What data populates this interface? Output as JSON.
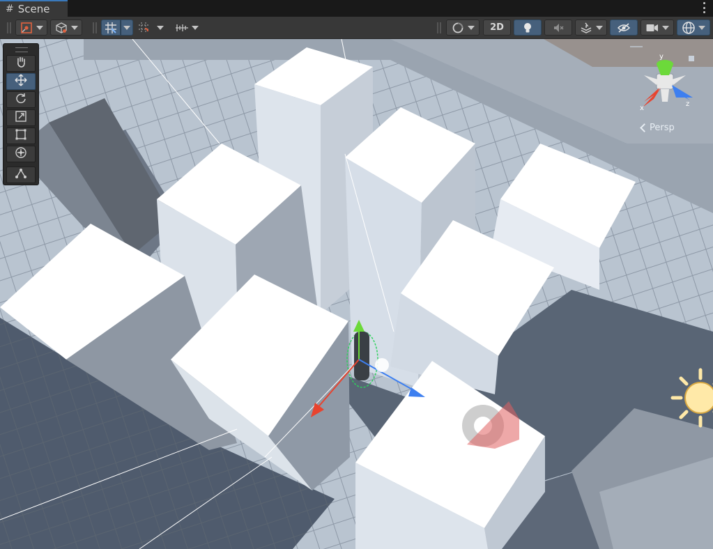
{
  "window": {
    "tab_label": "Scene"
  },
  "toolbar": {
    "draw_mode": "shaded",
    "render_mode_toggle_label": "2D",
    "lighting_enabled": true,
    "scene_visibility_enabled": true,
    "icons": [
      "gizmo-draw-mode-icon",
      "view-options-cube-icon",
      "grid-snap-icon",
      "increment-snap-icon",
      "grid-ruler-icon",
      "orbit-view-icon",
      "lighting-bulb-icon",
      "audio-mute-icon",
      "effects-layers-icon",
      "visibility-eye-icon",
      "camera-icon",
      "gizmos-globe-icon"
    ]
  },
  "tools": [
    {
      "id": "hand",
      "icon": "hand-tool-icon"
    },
    {
      "id": "move",
      "icon": "move-tool-icon",
      "active": true
    },
    {
      "id": "rotate",
      "icon": "rotate-tool-icon"
    },
    {
      "id": "scale",
      "icon": "scale-tool-icon"
    },
    {
      "id": "rect",
      "icon": "rect-tool-icon"
    },
    {
      "id": "transform",
      "icon": "transform-tool-icon"
    },
    {
      "id": "custom",
      "icon": "custom-tool-icon"
    }
  ],
  "orientation_gizmo": {
    "axis_y": "y",
    "axis_x": "x",
    "axis_z": "z",
    "projection_label": "Persp"
  },
  "colors": {
    "accent": "#46607c",
    "axis_x": "#e8432e",
    "axis_y": "#6cd93a",
    "axis_z": "#3d7ff0",
    "sun": "#ffd978"
  }
}
